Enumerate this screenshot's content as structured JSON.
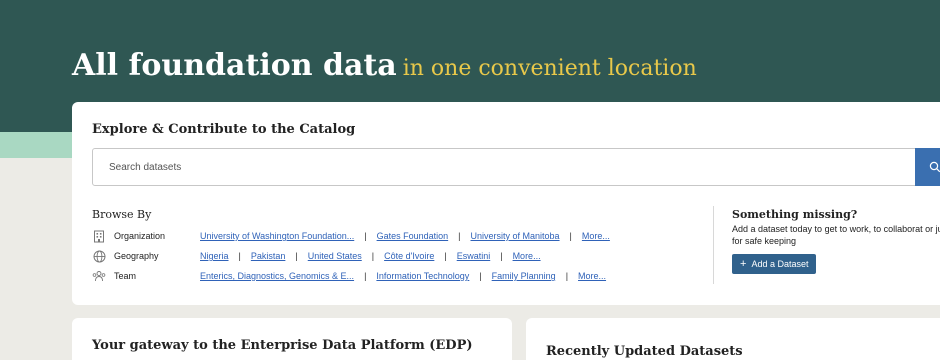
{
  "hero": {
    "title_main": "All foundation data",
    "title_accent": "in one convenient location"
  },
  "catalog": {
    "title": "Explore & Contribute to the Catalog",
    "search_placeholder": "Search datasets",
    "search_icon": "search-icon",
    "browse_title": "Browse By",
    "rows": [
      {
        "icon": "building-icon",
        "label": "Organization",
        "links": [
          "University of Washington Foundation...",
          "Gates Foundation",
          "University of Manitoba",
          "More..."
        ]
      },
      {
        "icon": "globe-icon",
        "label": "Geography",
        "links": [
          "Nigeria",
          "Pakistan",
          "United States",
          "Côte d'Ivoire",
          "Eswatini",
          "More..."
        ]
      },
      {
        "icon": "team-icon",
        "label": "Team",
        "links": [
          "Enterics, Diagnostics, Genomics & E...",
          "Information Technology",
          "Family Planning",
          "More..."
        ]
      }
    ],
    "missing": {
      "title": "Something missing?",
      "text": "Add a dataset today to get to work, to collaborat or just for safe keeping",
      "button_label": "Add a Dataset"
    }
  },
  "cards": {
    "gateway_title": "Your gateway to the Enterprise Data Platform (EDP)",
    "recent_title": "Recently Updated Datasets"
  },
  "colors": {
    "hero_bg": "#2f5753",
    "accent_yellow": "#e8c84a",
    "link_blue": "#2f62b8",
    "button_blue": "#30618c",
    "search_button": "#3a6fb0",
    "mint": "#a9d8c2"
  }
}
